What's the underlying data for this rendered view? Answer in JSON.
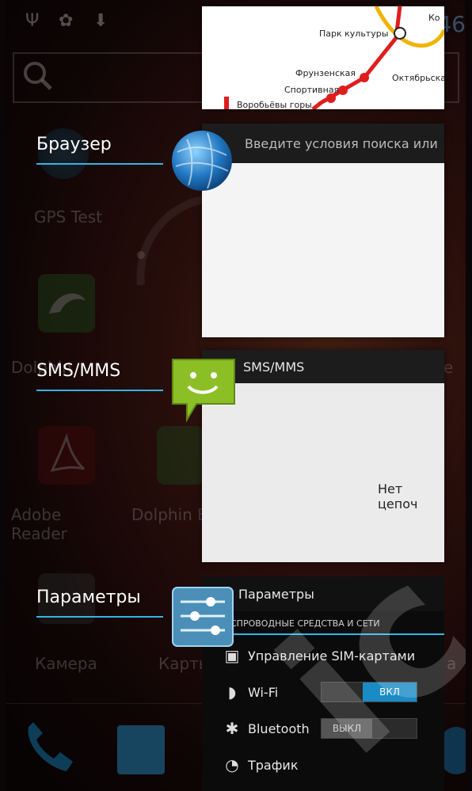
{
  "status_bar": {
    "clock_fragment": "46"
  },
  "home_screen": {
    "labels": {
      "gps_test": "GPS Test",
      "dolphin_left": "Dolphin",
      "dolphin_right_fragment": "e",
      "adobe_reader": "Adobe Reader",
      "dolphin_b": "Dolphin B",
      "camera": "Камера",
      "maps_fragment": "Карты",
      "right_fragment": "а"
    }
  },
  "recent_apps": [
    {
      "id": "metro",
      "map_labels": [
        "Парк культуры",
        "Фрунзенская",
        "Спортивная",
        "Воробьёвы горы",
        "Октябрьская",
        "Ко"
      ]
    },
    {
      "id": "browser",
      "label": "Браузер",
      "search_placeholder": "Введите условия поиска или"
    },
    {
      "id": "sms",
      "label": "SMS/MMS",
      "header": "SMS/MMS",
      "empty_text": "Нет цепоч"
    },
    {
      "id": "settings",
      "label": "Параметры",
      "header": "Параметры",
      "section": "СПРОВОДНЫЕ СРЕДСТВА И СЕТИ",
      "rows": [
        {
          "label": "Управление SIM-картами"
        },
        {
          "label": "Wi-Fi",
          "toggle": "ВКЛ"
        },
        {
          "label": "Bluetooth",
          "toggle": "ВЫКЛ"
        },
        {
          "label": "Трафик"
        }
      ]
    }
  ],
  "colors": {
    "accent": "#33b5e5",
    "toggle_on": "#1a8bc5"
  }
}
